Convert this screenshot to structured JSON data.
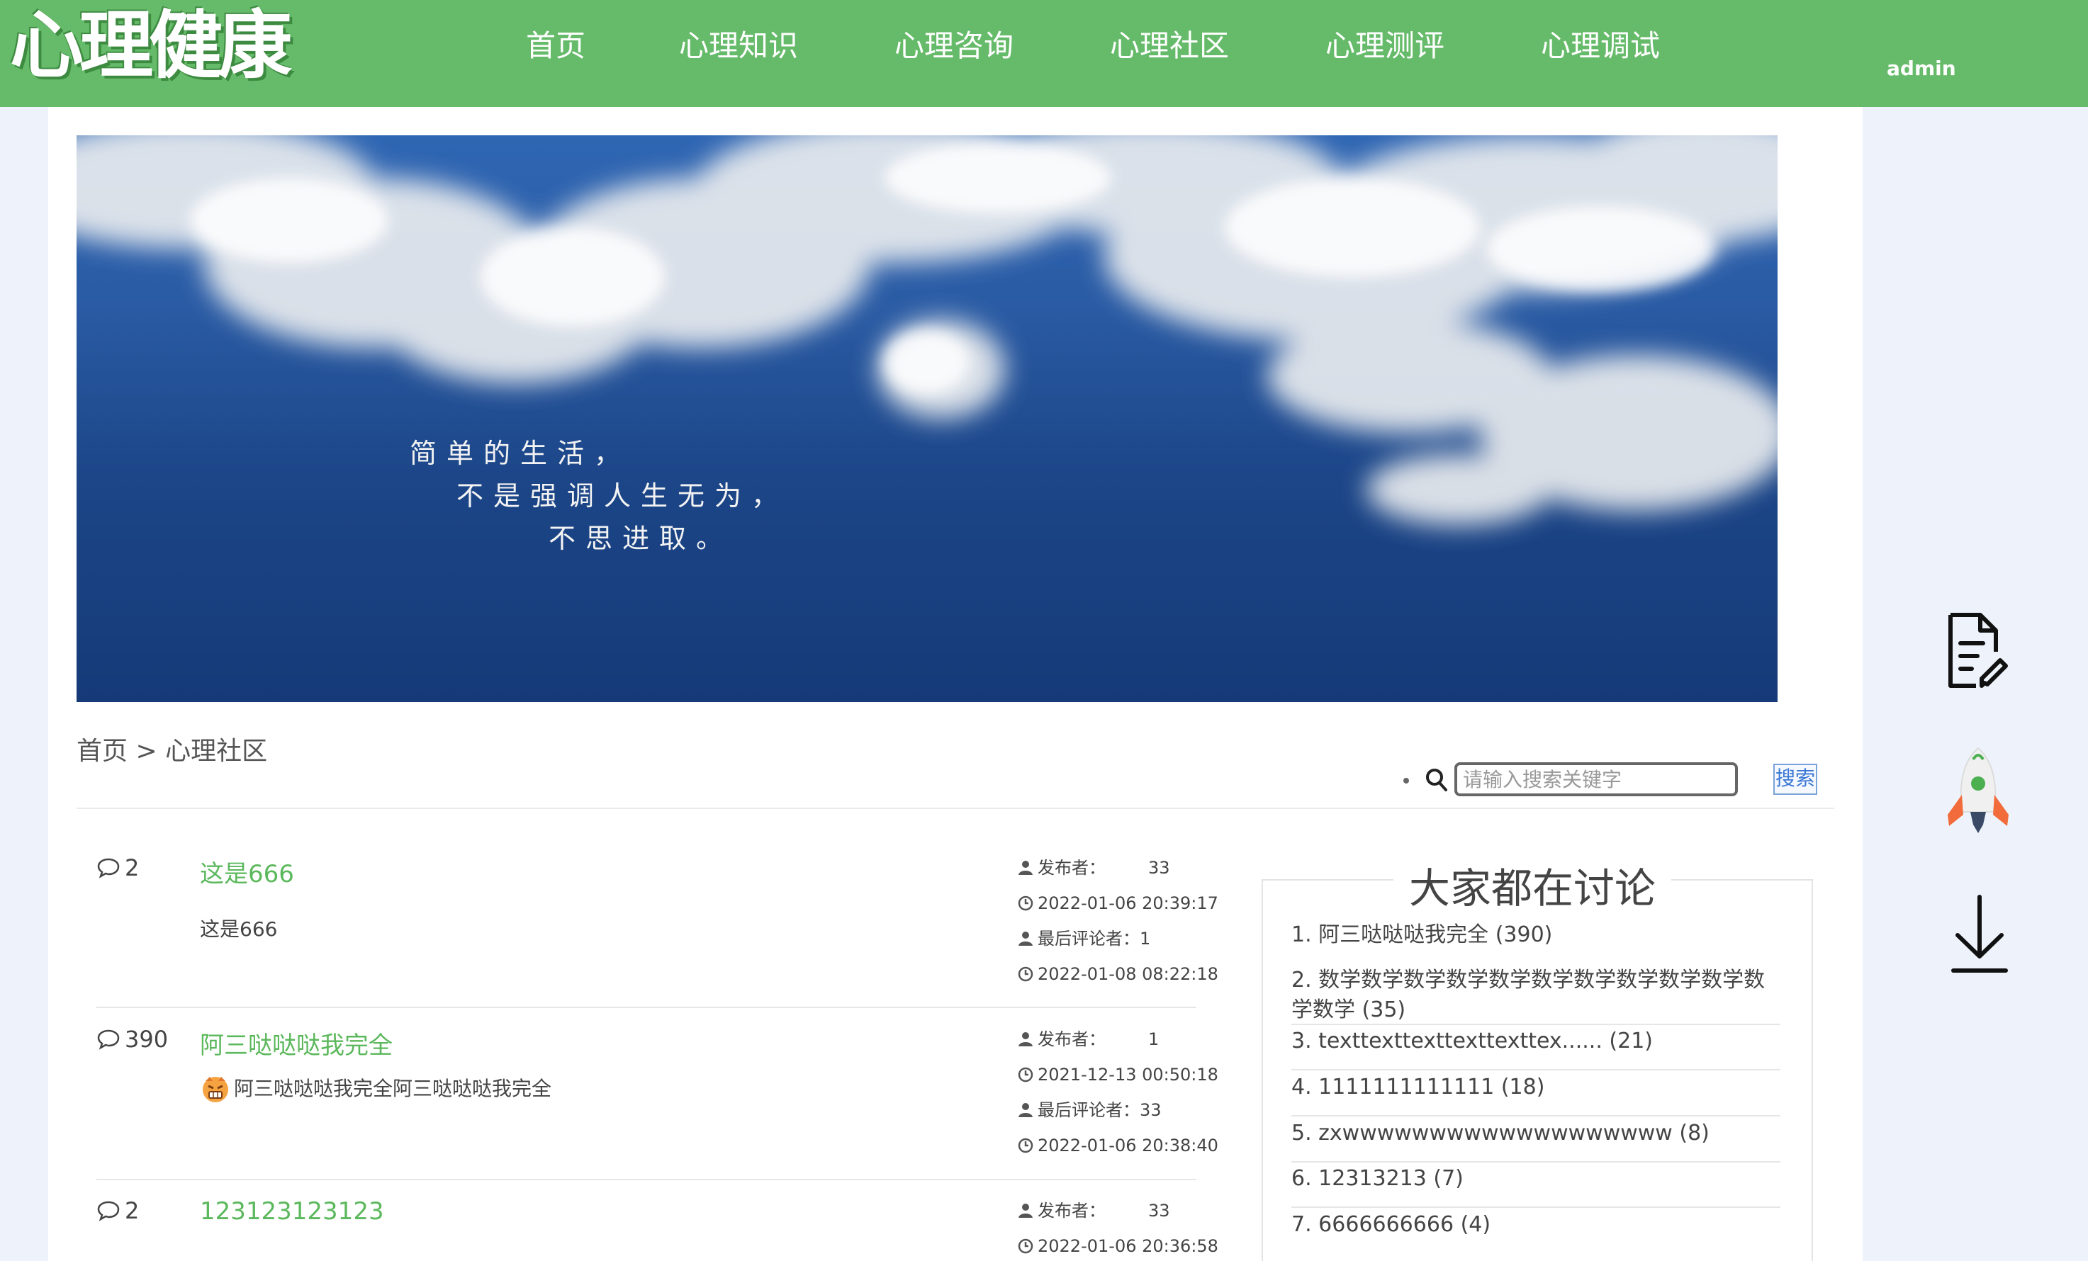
{
  "header": {
    "logo": "心理健康",
    "nav": [
      "首页",
      "心理知识",
      "心理咨询",
      "心理社区",
      "心理测评",
      "心理调试"
    ],
    "user": "admin"
  },
  "banner": {
    "lines": [
      "简单的生活，",
      "不是强调人生无为，",
      "不思进取。"
    ]
  },
  "breadcrumb": {
    "home": "首页",
    "sep": " > ",
    "current": "心理社区"
  },
  "search": {
    "placeholder": "请输入搜索关键字",
    "button": "搜索"
  },
  "posts": [
    {
      "count": "2",
      "title": "这是666",
      "body": "这是666",
      "publisher_label": "发布者：",
      "publisher": "33",
      "published": "2022-01-06 20:39:17",
      "last_label": "最后评论者：",
      "last_commenter": "1",
      "last_time": "2022-01-08 08:22:18"
    },
    {
      "count": "390",
      "title": "阿三哒哒哒我完全",
      "body": "阿三哒哒哒我完全阿三哒哒哒我完全",
      "publisher_label": "发布者：",
      "publisher": "1",
      "published": "2021-12-13 00:50:18",
      "last_label": "最后评论者：",
      "last_commenter": "33",
      "last_time": "2022-01-06 20:38:40"
    },
    {
      "count": "2",
      "title": "123123123123",
      "publisher_label": "发布者：",
      "publisher": "33",
      "published": "2022-01-06 20:36:58"
    }
  ],
  "hot": {
    "title": "大家都在讨论",
    "items": [
      "1.   阿三哒哒哒我完全  (390)",
      "2.   数学数学数学数学数学数学数学数学数学数学数学数学  (35)",
      "3.   texttexttexttexttexttex......  (21)",
      "4.   1111111111111  (18)",
      "5.   zxwwwwwwwwwwwwwwwwwww  (8)",
      "6.   12313213  (7)",
      "7.   6666666666  (4)"
    ]
  },
  "side_icons": [
    "document-edit-icon",
    "rocket-icon",
    "download-icon"
  ],
  "colors": {
    "header": "#66bb6a",
    "link": "#5cb85c",
    "page_bg": "#eef3fb"
  }
}
